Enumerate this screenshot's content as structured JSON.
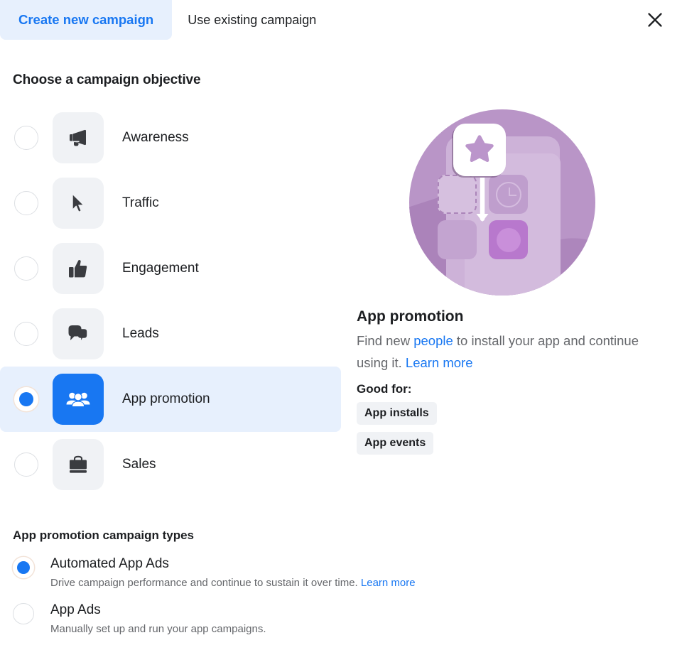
{
  "tabs": [
    {
      "label": "Create new campaign",
      "active": true
    },
    {
      "label": "Use existing campaign",
      "active": false
    }
  ],
  "close_icon": "close-icon",
  "section": {
    "title": "Choose a campaign objective"
  },
  "objectives": [
    {
      "label": "Awareness",
      "icon": "megaphone-icon",
      "selected": false
    },
    {
      "label": "Traffic",
      "icon": "cursor-icon",
      "selected": false
    },
    {
      "label": "Engagement",
      "icon": "thumbs-up-icon",
      "selected": false
    },
    {
      "label": "Leads",
      "icon": "chat-bubbles-icon",
      "selected": false
    },
    {
      "label": "App promotion",
      "icon": "people-group-icon",
      "selected": true
    },
    {
      "label": "Sales",
      "icon": "shopping-bag-icon",
      "selected": false
    }
  ],
  "detail": {
    "title": "App promotion",
    "desc_part1": "Find new ",
    "desc_link1": "people",
    "desc_part2": " to install your app and continue using it. ",
    "desc_link2": "Learn more",
    "good_for_label": "Good for:",
    "chips": [
      "App installs",
      "App events"
    ],
    "illustration": "app-promotion-illustration"
  },
  "campaign_types": {
    "title": "App promotion campaign types",
    "options": [
      {
        "name": "Automated App Ads",
        "desc": "Drive campaign performance and continue to sustain it over time. ",
        "link": "Learn more",
        "selected": true
      },
      {
        "name": "App Ads",
        "desc": "Manually set up and run your app campaigns.",
        "link": "",
        "selected": false
      }
    ]
  },
  "colors": {
    "accent": "#1877f2",
    "tab_active_bg": "#e7f0fd",
    "tile_bg": "#f0f2f5",
    "illustration_purple": "#b995c7",
    "text_secondary": "#65676b"
  }
}
